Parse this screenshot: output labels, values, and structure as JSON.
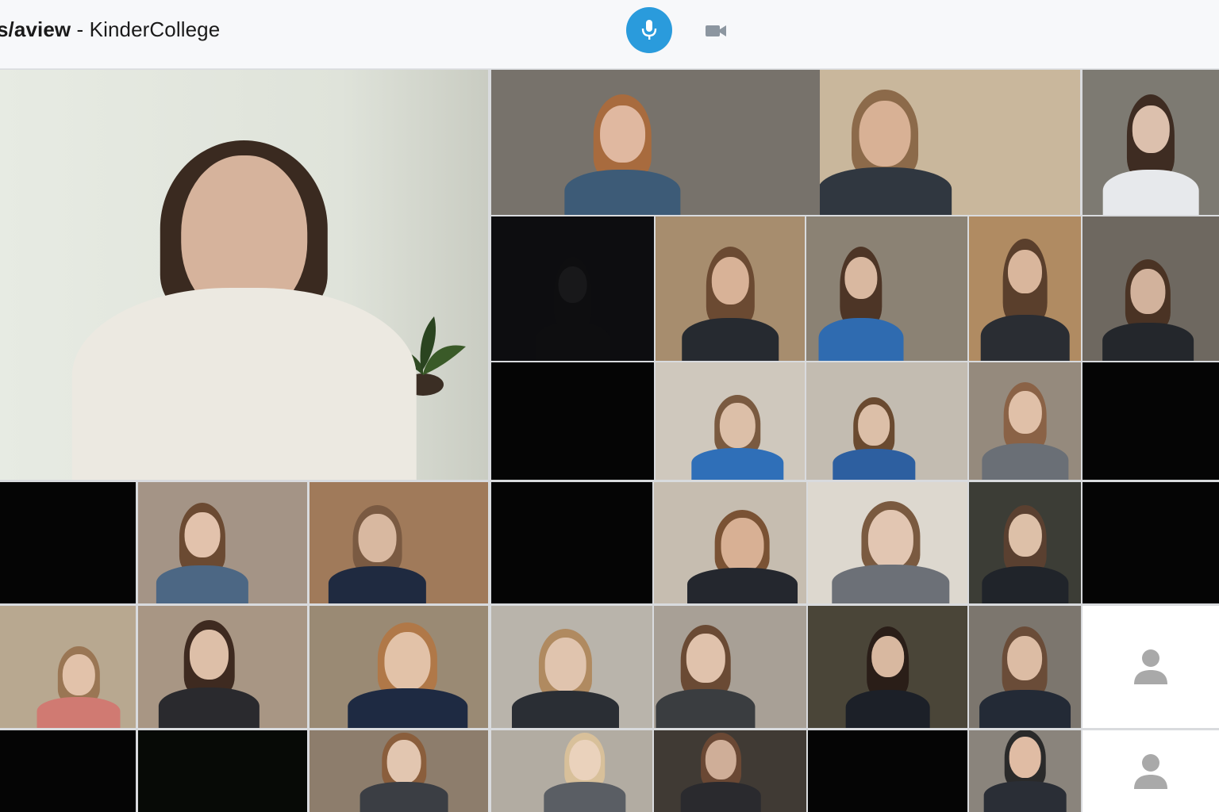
{
  "header": {
    "app_name": "s/aview",
    "separator": " - ",
    "meeting_name": "KinderCollege"
  },
  "controls": {
    "mic_icon": "microphone-icon",
    "camera_icon": "video-camera-icon",
    "accent_color": "#2a9bdc"
  },
  "participants": {
    "placeholder_icon": "person-placeholder-icon"
  }
}
